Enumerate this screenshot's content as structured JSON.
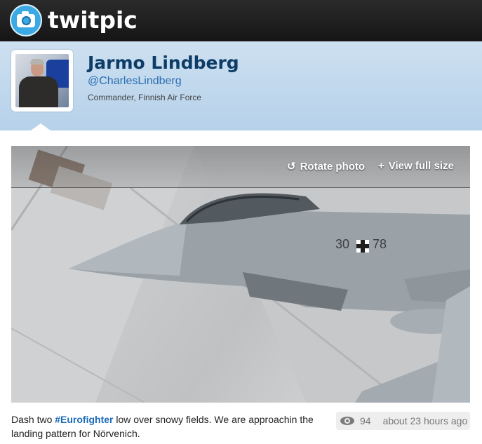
{
  "header": {
    "logo_text": "twitpic",
    "logo_icon": "camera-icon"
  },
  "profile": {
    "name": "Jarmo Lindberg",
    "handle": "@CharlesLindberg",
    "bio": "Commander, Finnish Air Force"
  },
  "photo": {
    "rotate_label": "Rotate photo",
    "rotate_icon": "rotate-icon",
    "full_size_label": "View full size",
    "full_size_icon": "plus-icon",
    "aircraft_marking_left": "30",
    "aircraft_marking_right": "78"
  },
  "caption": {
    "before": "Dash two ",
    "hashtag": "#Eurofighter",
    "after": " low over snowy fields. We are approachin the landing pattern for Nörvenich."
  },
  "stats": {
    "views_icon": "eye-icon",
    "views": "94",
    "posted": "about 23 hours ago"
  }
}
